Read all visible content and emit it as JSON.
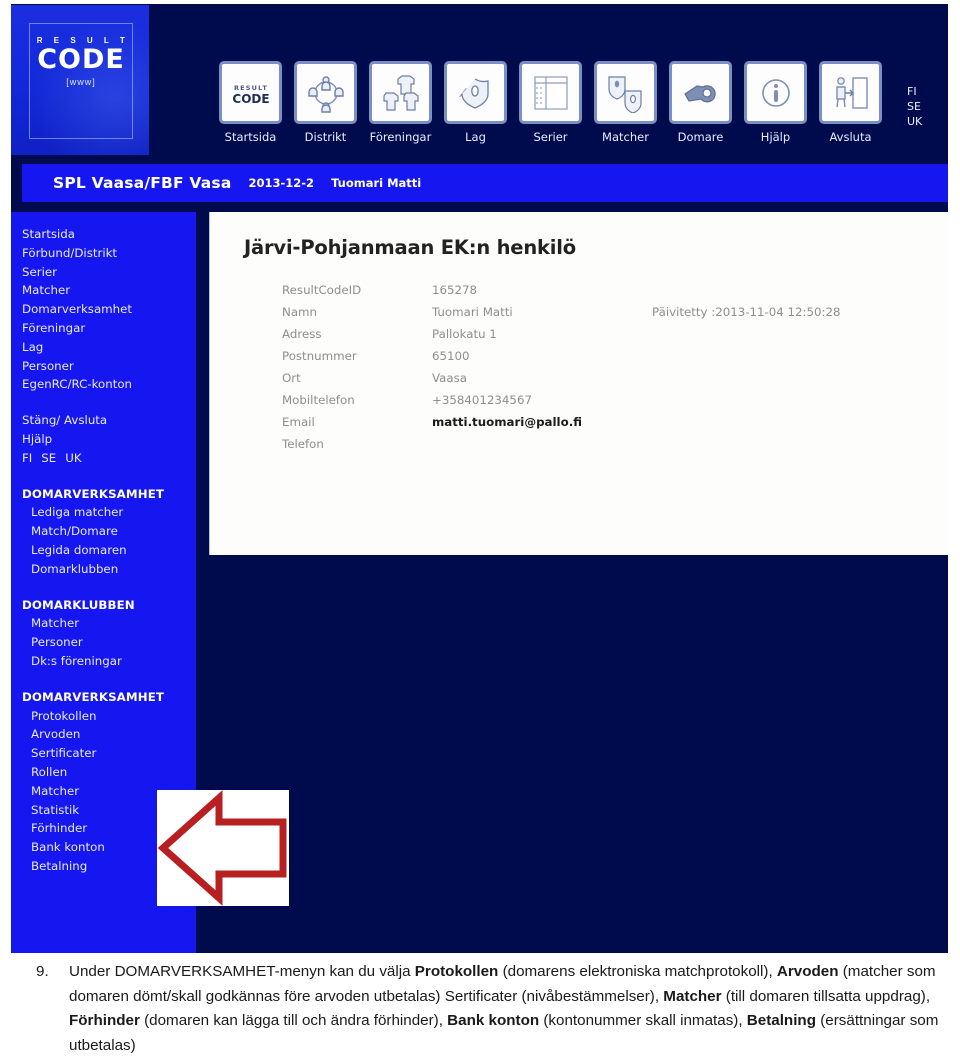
{
  "app": {
    "logo": {
      "result": "R E S U L T",
      "code": "CODE",
      "www": "[www]"
    },
    "nav": [
      {
        "label": "Startsida",
        "icon": "resultcode-logo-icon"
      },
      {
        "label": "Distrikt",
        "icon": "people-circle-icon"
      },
      {
        "label": "Föreningar",
        "icon": "team-shirts-icon"
      },
      {
        "label": "Lag",
        "icon": "shield-flag-icon"
      },
      {
        "label": "Serier",
        "icon": "standings-table-icon"
      },
      {
        "label": "Matcher",
        "icon": "two-shields-icon"
      },
      {
        "label": "Domare",
        "icon": "whistle-icon"
      },
      {
        "label": "Hjälp",
        "icon": "info-circle-icon"
      },
      {
        "label": "Avsluta",
        "icon": "exit-door-icon"
      }
    ],
    "languages": [
      "FI",
      "SE",
      "UK"
    ]
  },
  "context": {
    "organisation": "SPL Vaasa/FBF Vasa",
    "date": "2013-12-2",
    "user": "Tuomari Matti"
  },
  "sidebar": {
    "main_links": [
      "Startsida",
      "Förbund/Distrikt",
      "Serier",
      "Matcher",
      "Domarverksamhet",
      "Föreningar",
      "Lag",
      "Personer",
      "EgenRC/RC-konton"
    ],
    "utility_links": [
      "Stäng/ Avsluta",
      "Hjälp"
    ],
    "languages": [
      "FI",
      "SE",
      "UK"
    ],
    "groups": [
      {
        "heading": "DOMARVERKSAMHET",
        "items": [
          "Lediga matcher",
          "Match/Domare",
          "Legida domaren",
          "Domarklubben"
        ]
      },
      {
        "heading": "DOMARKLUBBEN",
        "items": [
          "Matcher",
          "Personer",
          "Dk:s föreningar"
        ]
      },
      {
        "heading": "DOMARVERKSAMHET",
        "items": [
          "Protokollen",
          "Arvoden",
          "Sertificater",
          "Rollen",
          "Matcher",
          "Statistik",
          "Förhinder",
          "Bank konton",
          "Betalning"
        ]
      }
    ]
  },
  "content": {
    "title": "Järvi-Pohjanmaan EK:n henkilö",
    "updated_label": "Päivitetty :2013-11-04 12:50:28",
    "fields": [
      {
        "label": "ResultCodeID",
        "value": "165278"
      },
      {
        "label": "Namn",
        "value": "Tuomari Matti"
      },
      {
        "label": "Adress",
        "value": "Pallokatu 1"
      },
      {
        "label": "Postnummer",
        "value": "65100"
      },
      {
        "label": "Ort",
        "value": "Vaasa"
      },
      {
        "label": "Mobiltelefon",
        "value": "+358401234567"
      },
      {
        "label": "Email",
        "value": "matti.tuomari@pallo.fi"
      },
      {
        "label": "Telefon",
        "value": ""
      }
    ]
  },
  "callout": {
    "icon": "left-arrow-icon",
    "color": "#b81f21"
  },
  "caption": {
    "number": "9.",
    "segments": [
      {
        "text": "Under DOMARVERKSAMHET-menyn kan du välja ",
        "bold": false
      },
      {
        "text": "Protokollen",
        "bold": true
      },
      {
        "text": " (domarens elektroniska matchprotokoll), ",
        "bold": false
      },
      {
        "text": "Arvoden",
        "bold": true
      },
      {
        "text": " (matcher som domaren dömt/skall godkännas före arvoden utbetalas) Sertificater (nivåbestämmelser), ",
        "bold": false
      },
      {
        "text": "Matcher",
        "bold": true
      },
      {
        "text": " (till domaren tillsatta uppdrag), ",
        "bold": false
      },
      {
        "text": "Förhinder",
        "bold": true
      },
      {
        "text": " (domaren kan lägga till och ändra förhinder), ",
        "bold": false
      },
      {
        "text": "Bank konton",
        "bold": true
      },
      {
        "text": " (kontonummer skall inmatas),  ",
        "bold": false
      },
      {
        "text": "Betalning",
        "bold": true
      },
      {
        "text": " (ersättningar som utbetalas)",
        "bold": false
      }
    ]
  },
  "colors": {
    "window_bg": "#000b4d",
    "panel_blue": "#1616f0",
    "content_bg": "#fdfdfb",
    "arrow_red": "#b81f21"
  }
}
